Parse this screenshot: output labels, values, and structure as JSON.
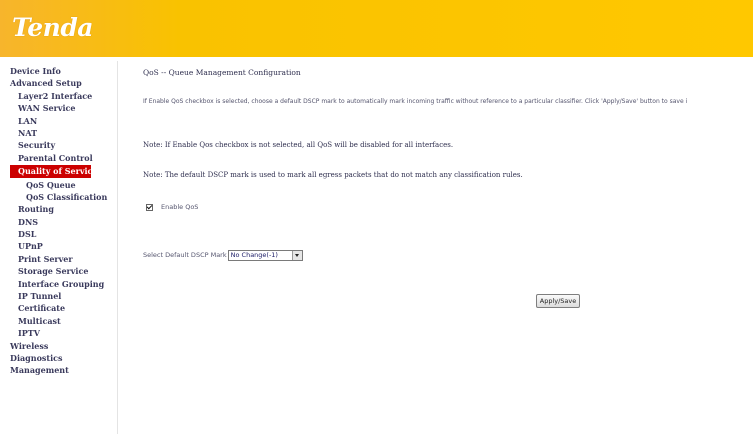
{
  "brand": {
    "logo_text": "Tenda",
    "logo_mark": "R"
  },
  "sidebar": {
    "items": [
      {
        "label": "Device Info",
        "level": 0,
        "active": false
      },
      {
        "label": "Advanced Setup",
        "level": 0,
        "active": false
      },
      {
        "label": "Layer2 Interface",
        "level": 1,
        "active": false
      },
      {
        "label": "WAN Service",
        "level": 1,
        "active": false
      },
      {
        "label": "LAN",
        "level": 1,
        "active": false
      },
      {
        "label": "NAT",
        "level": 1,
        "active": false
      },
      {
        "label": "Security",
        "level": 1,
        "active": false
      },
      {
        "label": "Parental Control",
        "level": 1,
        "active": false
      },
      {
        "label": "Quality of Service",
        "level": 1,
        "active": true
      },
      {
        "label": "QoS Queue",
        "level": 2,
        "active": false
      },
      {
        "label": "QoS Classification",
        "level": 2,
        "active": false
      },
      {
        "label": "Routing",
        "level": 1,
        "active": false
      },
      {
        "label": "DNS",
        "level": 1,
        "active": false
      },
      {
        "label": "DSL",
        "level": 1,
        "active": false
      },
      {
        "label": "UPnP",
        "level": 1,
        "active": false
      },
      {
        "label": "Print Server",
        "level": 1,
        "active": false
      },
      {
        "label": "Storage Service",
        "level": 1,
        "active": false
      },
      {
        "label": "Interface Grouping",
        "level": 1,
        "active": false
      },
      {
        "label": "IP Tunnel",
        "level": 1,
        "active": false
      },
      {
        "label": "Certificate",
        "level": 1,
        "active": false
      },
      {
        "label": "Multicast",
        "level": 1,
        "active": false
      },
      {
        "label": "IPTV",
        "level": 1,
        "active": false
      },
      {
        "label": "Wireless",
        "level": 0,
        "active": false
      },
      {
        "label": "Diagnostics",
        "level": 0,
        "active": false
      },
      {
        "label": "Management",
        "level": 0,
        "active": false
      }
    ]
  },
  "main": {
    "title": "QoS -- Queue Management Configuration",
    "description": "If Enable QoS checkbox is selected, choose a default DSCP mark to automatically mark incoming traffic without reference to a particular classifier. Click 'Apply/Save' button to save i",
    "note1": "Note: If Enable Qos checkbox is not selected, all QoS will be disabled for all interfaces.",
    "note2": "Note: The default DSCP mark is used to mark all egress packets that do not match any classification rules.",
    "enable_qos_label": "Enable QoS",
    "enable_qos_checked": true,
    "dscp_label": "Select Default DSCP Mark",
    "dscp_value": "No Change(-1)",
    "apply_label": "Apply/Save"
  },
  "colors": {
    "header": "#ffc800",
    "active_nav": "#cc0000",
    "text": "#3a3a5c"
  }
}
